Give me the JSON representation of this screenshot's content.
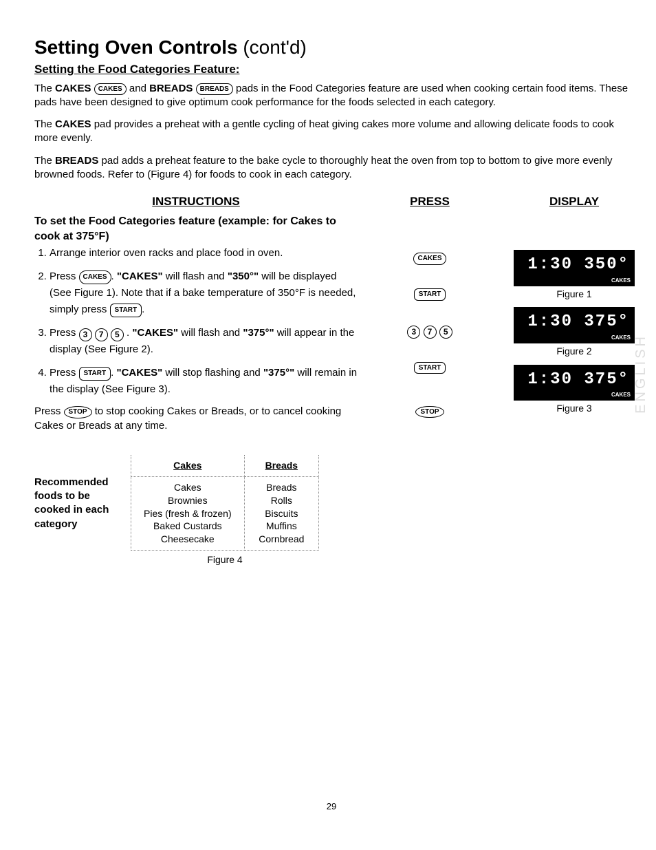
{
  "title_bold": "Setting Oven Controls",
  "title_cont": " (cont'd)",
  "subtitle": "Setting the Food Categories Feature:",
  "intro1_pre": "The ",
  "intro1_cakes": "CAKES",
  "cakes_pad": "CAKES",
  "intro1_and": " and ",
  "intro1_breads": "BREADS",
  "breads_pad": "BREADS",
  "intro1_post": " pads in the Food Categories feature are used when cooking certain food items. These pads have been designed to give optimum cook performance for the foods selected in each category.",
  "para2_pre": "The ",
  "para2_bold": "CAKES",
  "para2_post": " pad provides a preheat with a gentle cycling of heat giving cakes more volume and allowing delicate foods to cook more evenly.",
  "para3_pre": "The ",
  "para3_bold": "BREADS",
  "para3_post": " pad adds a preheat feature to the bake cycle to thoroughly heat the oven from top to bottom to give more evenly browned foods. Refer to (Figure 4) for foods to cook in each category.",
  "col_instructions": "INSTRUCTIONS",
  "col_press": "PRESS",
  "col_display": "DISPLAY",
  "example_head": "To set the Food Categories feature (example: for Cakes to cook at 375°F)",
  "step1": "Arrange interior oven racks and place food in oven.",
  "step2_a": "Press ",
  "step2_pad": "CAKES",
  "step2_b": ". ",
  "step2_bold1": "\"CAKES\"",
  "step2_c": " will flash and ",
  "step2_bold2": "\"350°\"",
  "step2_d": " will be displayed (See Figure 1). Note that if a bake temperature of 350°F is needed, simply press ",
  "step2_pad2": "START",
  "step2_e": ".",
  "step3_a": "Press ",
  "step3_n1": "3",
  "step3_n2": "7",
  "step3_n3": "5",
  "step3_b": " . ",
  "step3_bold1": "\"CAKES\"",
  "step3_c": " will flash and ",
  "step3_bold2": "\"375°\"",
  "step3_d": " will appear in the display (See Figure 2).",
  "step4_a": "Press ",
  "step4_pad": "START",
  "step4_b": ". ",
  "step4_bold1": "\"CAKES\"",
  "step4_c": " will stop flashing and ",
  "step4_bold2": "\"375°\"",
  "step4_d": " will remain in the display (See Figure 3).",
  "stop_a": "Press ",
  "stop_pad": "STOP",
  "stop_b": " to stop cooking Cakes or Breads, or to cancel cooking Cakes or Breads at any time.",
  "press_cakes": "CAKES",
  "press_start": "START",
  "press_stop": "STOP",
  "press_3": "3",
  "press_7": "7",
  "press_5": "5",
  "lcd1": "1:30 350°",
  "lcd1_tag": "CAKES",
  "fig1": "Figure 1",
  "lcd2": "1:30 375°",
  "lcd2_tag": "CAKES",
  "fig2": "Figure 2",
  "lcd3": "1:30 375°",
  "lcd3_tag": "CAKES",
  "fig3": "Figure 3",
  "rec_label": "Recommended foods to be cooked in each category",
  "tbl_cakes": "Cakes",
  "tbl_breads": "Breads",
  "cakes_items": "Cakes\nBrownies\nPies (fresh & frozen)\nBaked Custards\nCheesecake",
  "breads_items": "Breads\nRolls\nBiscuits\nMuffins\nCornbread",
  "fig4": "Figure 4",
  "page_num": "29",
  "side_text": "ENGLISH"
}
